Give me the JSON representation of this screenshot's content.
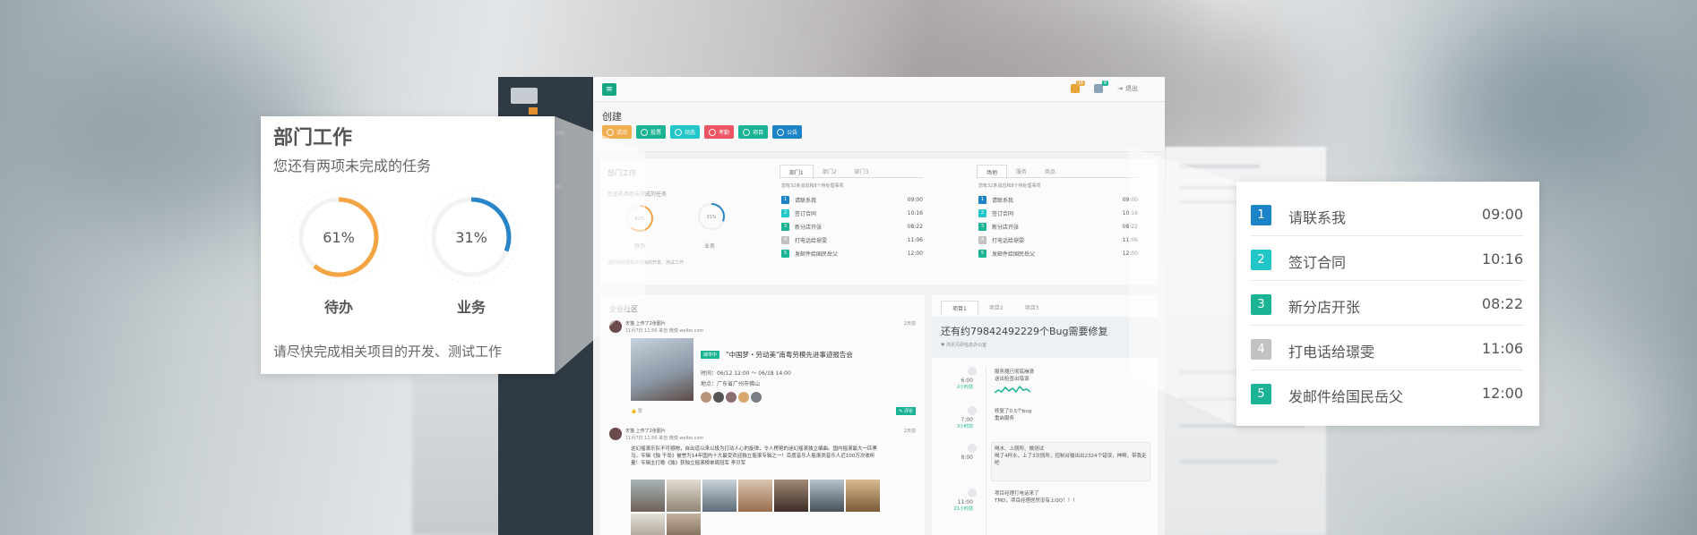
{
  "colors": {
    "orange": "#e58f2e",
    "green_teal": "#1ab394",
    "blue": "#1c84c6",
    "cyan": "#23c6c8",
    "red": "#ed5565",
    "gray": "#c2c2c2",
    "ring_orange": "#f5a443",
    "ring_blue": "#2a84c8"
  },
  "topbar": {
    "menu_icon": "menu-icon",
    "notice_count": "16",
    "message_count": "8",
    "logout_label": "退出"
  },
  "create": {
    "title": "创建",
    "buttons": [
      {
        "label": "活动",
        "color": "#f0ad4e"
      },
      {
        "label": "投票",
        "color": "#1ab394"
      },
      {
        "label": "动态",
        "color": "#23c6c8"
      },
      {
        "label": "考勤",
        "color": "#ed5565"
      },
      {
        "label": "项目",
        "color": "#1ab394"
      },
      {
        "label": "公告",
        "color": "#1c84c6"
      }
    ]
  },
  "dept_panel": {
    "title": "部门工作",
    "subtitle": "您还有两项未完成的任务",
    "rings": [
      {
        "percent": 61,
        "value_label": "61%",
        "label": "待办"
      },
      {
        "percent": 31,
        "value_label": "31%",
        "label": "业务"
      }
    ],
    "note": "请尽快完成相关项目的开发、测试工作"
  },
  "dept_tabs": [
    "部门1",
    "部门2",
    "部门3"
  ],
  "place_tabs": [
    "场地",
    "服务",
    "商品"
  ],
  "mini_caption": "您有32条消息和8个待处理事项",
  "tasks": [
    {
      "num": "1",
      "text": "请联系我",
      "time": "09:00",
      "color": "#1c84c6"
    },
    {
      "num": "2",
      "text": "签订合同",
      "time": "10:16",
      "color": "#23c6c8"
    },
    {
      "num": "3",
      "text": "新分店开张",
      "time": "08:22",
      "color": "#1ab394"
    },
    {
      "num": "4",
      "text": "打电话给璟雯",
      "time": "11:06",
      "color": "#c2c2c2"
    },
    {
      "num": "5",
      "text": "发邮件给国民岳父",
      "time": "12:00",
      "color": "#1ab394"
    }
  ],
  "community": {
    "title": "企业社区",
    "post1": {
      "author": "天猫 上传了2张图片",
      "meta": "11月7日 11:56 来自 微博 weibo.com",
      "ago": "2天前",
      "tag": "城市中",
      "headline": "\"中国梦・劳动美\"南粤劳模先进事迹报告会",
      "time_line": "时间：06/12 12:00 ～ 06/18 14:00",
      "place_line": "地点：广东省广州市佛山",
      "like": "赞",
      "reply": "评论"
    },
    "post2": {
      "author": "天猫 上传了2张图片",
      "meta": "11月7日 11:56 来自 微博 weibo.com",
      "ago": "2天前",
      "text": "这幻摇滚乐队不可撼物，自出道以来以极为打动人心的旋律，令人楞艳的迷幻摇滚独立编曲。国内摇滚最大一匹黑马。专辑《独 千岛》被誉为14年国内十大最受欢迎独立摇滚专辑之一！百度音乐人摇滚类音乐人近100万次收听量！专辑主打歌《独》获独立摇滚榜单周冠军 李贝军"
    }
  },
  "bug_panel": {
    "tabs": [
      "项目1",
      "项目2",
      "项目3"
    ],
    "title": "还有约79842492229个Bug需要修复",
    "subtitle": "♥ 鸿讯贝研信息办公室",
    "timeline": [
      {
        "time": "6:00",
        "ago": "2小时前",
        "text": "服务器已彻底崩溃",
        "detail": "送出检查出错误"
      },
      {
        "time": "7:00",
        "ago": "3小时前",
        "text": "修复了0.5个bug",
        "detail": "重启服务"
      },
      {
        "time": "8:00",
        "ago": "",
        "text": "喝水、上厕所、做测试",
        "detail": "喝了4杯水，上了3次厕所，控制台输出出2324个错误，神啊，带我走吧"
      },
      {
        "time": "11:00",
        "ago": "21小时前",
        "text": "项目经理打电话来了",
        "detail": "TMD，项目经理居然没有上QQ！！！"
      }
    ]
  }
}
